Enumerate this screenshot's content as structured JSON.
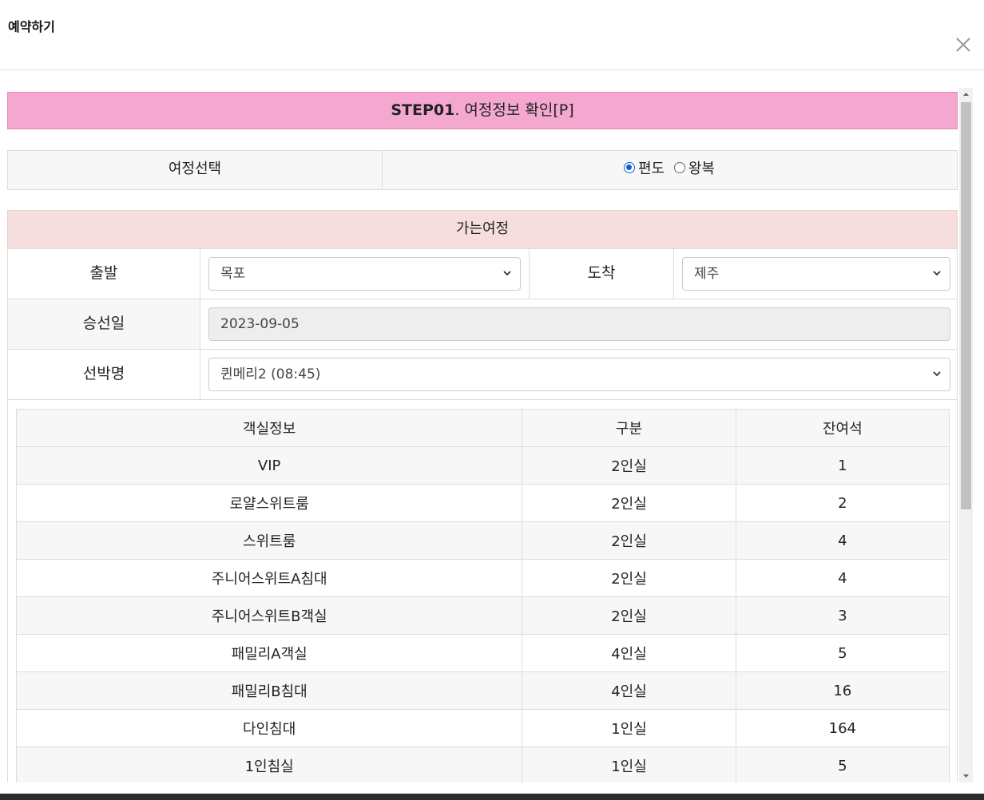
{
  "modal": {
    "title": "예약하기"
  },
  "step": {
    "prefix": "STEP01",
    "text": ". 여정정보 확인[P]"
  },
  "trip_select": {
    "label": "여정선택",
    "options": [
      {
        "label": "편도",
        "checked": true
      },
      {
        "label": "왕복",
        "checked": false
      }
    ]
  },
  "outbound": {
    "section_title": "가는여정",
    "departure_label": "출발",
    "departure_value": "목포",
    "arrival_label": "도착",
    "arrival_value": "제주",
    "date_label": "승선일",
    "date_value": "2023-09-05",
    "ship_label": "선박명",
    "ship_value": "퀸메리2 (08:45)"
  },
  "rooms": {
    "headers": [
      "객실정보",
      "구분",
      "잔여석"
    ],
    "rows": [
      [
        "VIP",
        "2인실",
        "1"
      ],
      [
        "로얄스위트룸",
        "2인실",
        "2"
      ],
      [
        "스위트룸",
        "2인실",
        "4"
      ],
      [
        "주니어스위트A침대",
        "2인실",
        "4"
      ],
      [
        "주니어스위트B객실",
        "2인실",
        "3"
      ],
      [
        "패밀리A객실",
        "4인실",
        "5"
      ],
      [
        "패밀리B침대",
        "4인실",
        "16"
      ],
      [
        "다인침대",
        "1인실",
        "164"
      ],
      [
        "1인침실",
        "1인실",
        "5"
      ]
    ]
  },
  "colors": {
    "step_bar": "#f4a8cf",
    "section_head": "#f7dede",
    "radio_checked": "#0b62d6"
  }
}
